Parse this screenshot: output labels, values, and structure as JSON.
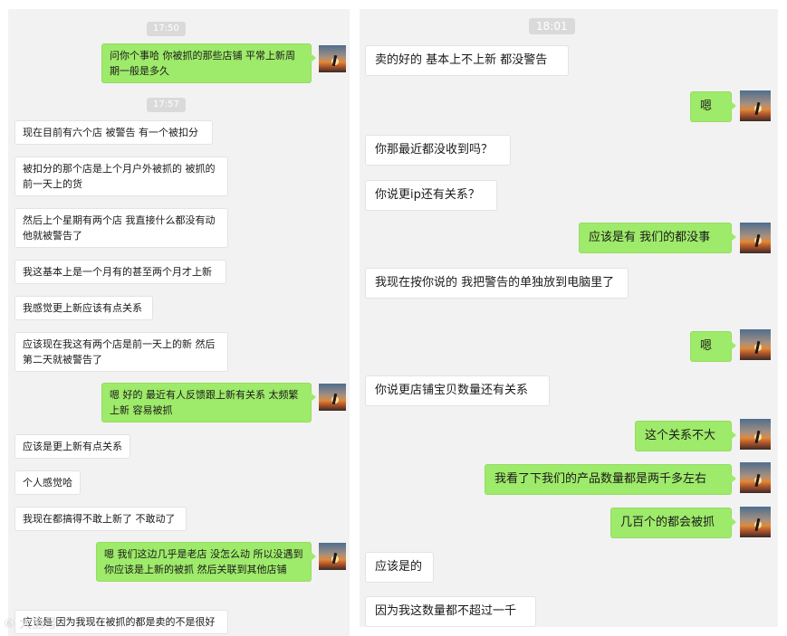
{
  "left_panel": {
    "timestamps": [
      "17:50",
      "17:57"
    ],
    "messages": [
      {
        "dir": "out",
        "text": "问你个事哈  你被抓的那些店铺 平常上新周期一般是多久"
      },
      {
        "dir": "in",
        "text": "现在目前有六个店 被警告 有一个被扣分"
      },
      {
        "dir": "in",
        "text": "被扣分的那个店是上个月户外被抓的 被抓的前一天上的货"
      },
      {
        "dir": "in",
        "text": "然后上个星期有两个店 我直接什么都没有动 他就被警告了"
      },
      {
        "dir": "in",
        "text": "我这基本上是一个月有的甚至两个月才上新"
      },
      {
        "dir": "in",
        "text": "我感觉更上新应该有点关系"
      },
      {
        "dir": "in",
        "text": "应该现在我这有两个店是前一天上的新 然后第二天就被警告了"
      },
      {
        "dir": "out",
        "text": "嗯 好的  最近有人反馈跟上新有关系 太频繁上新 容易被抓"
      },
      {
        "dir": "in",
        "text": "应该是更上新有点关系"
      },
      {
        "dir": "in",
        "text": "个人感觉哈"
      },
      {
        "dir": "in",
        "text": "我现在都搞得不敢上新了 不敢动了"
      },
      {
        "dir": "out",
        "text": "嗯 我们这边几乎是老店 没怎么动  所以没遇到   你应该是上新的被抓  然后关联到其他店铺"
      },
      {
        "dir": "in",
        "text": "应该是  因为我现在被抓的都是卖的不是很好"
      }
    ]
  },
  "right_panel": {
    "timestamp": "18:01",
    "messages": [
      {
        "dir": "in",
        "text": "卖的好的 基本上不上新 都没警告"
      },
      {
        "dir": "out",
        "text": "嗯"
      },
      {
        "dir": "in",
        "text": "你那最近都没收到吗？"
      },
      {
        "dir": "in",
        "text": "你说更ip还有关系？"
      },
      {
        "dir": "out",
        "text": "应该是有  我们的都没事"
      },
      {
        "dir": "in",
        "text": "我现在按你说的 我把警告的单独放到电脑里了"
      },
      {
        "dir": "out",
        "text": "嗯"
      },
      {
        "dir": "in",
        "text": "你说更店铺宝贝数量还有关系"
      },
      {
        "dir": "out",
        "text": "这个关系不大"
      },
      {
        "dir": "out",
        "text": "我看了下我们的产品数量都是两千多左右"
      },
      {
        "dir": "out",
        "text": "几百个的都会被抓"
      },
      {
        "dir": "in",
        "text": "应该是的"
      },
      {
        "dir": "in",
        "text": "因为我这数量都不超过一千"
      }
    ]
  },
  "watermark": "⑥ 大鱼号",
  "colors": {
    "outgoing": "#9eea6a",
    "incoming": "#ffffff",
    "panel_bg": "#f2f2f2",
    "timestamp_bg": "#dadada"
  }
}
